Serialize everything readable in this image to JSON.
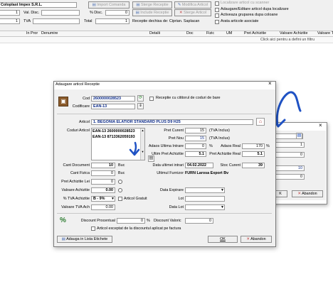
{
  "main": {
    "client_name": "Coloplast Impex S.R.L.",
    "val_disc_label": "Val. Disc.",
    "pct_disc_label": "% Disc.",
    "pct_disc_value": "0",
    "import_comanda": "Import Comanda",
    "sterge_receptie": "Sterge Receptie",
    "modifica_articol": "Modifica Articol",
    "include_receptie": "Include Receptie",
    "sterge_articol": "Sterge Articol",
    "row1_value": "1",
    "row2_value": "1",
    "tva_label": "TVA",
    "total_label": "Total",
    "total_value": "1",
    "receptie_text": "Receptie dechisa de: Ciprian. Saplacan",
    "localizare_scanner": "Localizare articol cu scanner",
    "adaugare_localizare": "Adaugare/Editare articol dupa localizare",
    "activeaza_gruparea": "Activeaza gruparea dupa coloane",
    "arata_articole": "Arata articole asociate",
    "columns": [
      "",
      "In Pror",
      "Denumire",
      "Detalii",
      "Doc",
      "Fizic",
      "UM",
      "Pret Achizitie",
      "Valoare Achizitie",
      "Valoare TVA"
    ],
    "filter_hint": "Click aici pentru a defini un filtru"
  },
  "dialog": {
    "title": "Adaugare articol Receptie",
    "close": "×",
    "cod_label": "Cod",
    "cod_value": "2600000028523",
    "receptie_cititorul": "Receptie cu cititorul de coduri de bare",
    "codificare_label": "Codificare",
    "codificare_value": "EAN-13",
    "articol_label": "Articol",
    "articol_value": "1. BEGONIA ELATIOR STANDARD PLUS D9 H25",
    "coduri_label": "Coduri Articol",
    "coduri": [
      "EAN-13 2600000028523",
      "EAN-13 8713362059193"
    ],
    "pret_curent_label": "Pret Curent",
    "pret_curent_value": "15",
    "pret_curent_suffix": "(TVA Inclus)",
    "pret_nou_label": "Pret Nou",
    "pret_nou_value": "15",
    "pret_nou_suffix": "(TVA Inclus)",
    "adaos_ultima_label": "Adaos Ultima Intrare",
    "adaos_ultima_value": "0",
    "adaos_ultima_pct": "%",
    "adaos_real_label": "Adaos Real",
    "adaos_real_value": "170",
    "adaos_real_pct": "%",
    "ultim_pret_label": "Ultim Pret Achizitie",
    "ultim_pret_value": "5.1",
    "pret_achizitie_real_label": "Pret Achizitie Real",
    "pret_achizitie_real_value": "5.1",
    "cant_document_label": "Cant Document",
    "cant_document_value": "10",
    "buc1": "Buc",
    "data_ultimei_label": "Data ultimei intrari",
    "data_ultimei_value": "04.02.2022",
    "stoc_curent_label": "Stoc Curent",
    "stoc_curent_value": "39",
    "cant_fizica_label": "Cant Fizica",
    "cant_fizica_value": "0",
    "buc2": "Buc",
    "ultimul_furnizor_label": "Ultimul Furnizor",
    "ultimul_furnizor_value": "FURN Larosa Export Bv",
    "pret_lei_label": "Pret Achizitie Lei",
    "pret_lei_value": "0",
    "valoare_achizitie_label": "Valoare Achizitie",
    "valoare_achizitie_value": "0.00",
    "tva_achizitie_label": "% TVA Achizitie",
    "tva_achizitie_value": "B - 9%",
    "articol_gratuit": "Articol Gratuit",
    "valoare_tva_label": "Valoare TVA Ach",
    "valoare_tva_value": "0.00",
    "data_expirare_label": "Data Expirare",
    "lot_label": "Lot",
    "data_lot_label": "Data Lot",
    "discount_procentual_label": "Discount Procentual",
    "discount_procentual_value": "0",
    "discount_pct": "%",
    "discount_valoric_label": "Discount Valoric",
    "discount_valoric_value": "0",
    "articol_exceptat": "Articol exceptat de la discountul aplicat pe factura",
    "adauga_lista": "Adauga in Lista Etichete",
    "ok": "OK",
    "abandon": "Abandon"
  },
  "back_dialog": {
    "close": "×",
    "v1": "1",
    "v2": "0",
    "v3": "10",
    "v4": "0",
    "abandon": "Abandon"
  },
  "colors": {
    "accent": "#1f52c4",
    "dialog_bg": "#f0f0f0",
    "header_bg": "#f0f0f0"
  }
}
